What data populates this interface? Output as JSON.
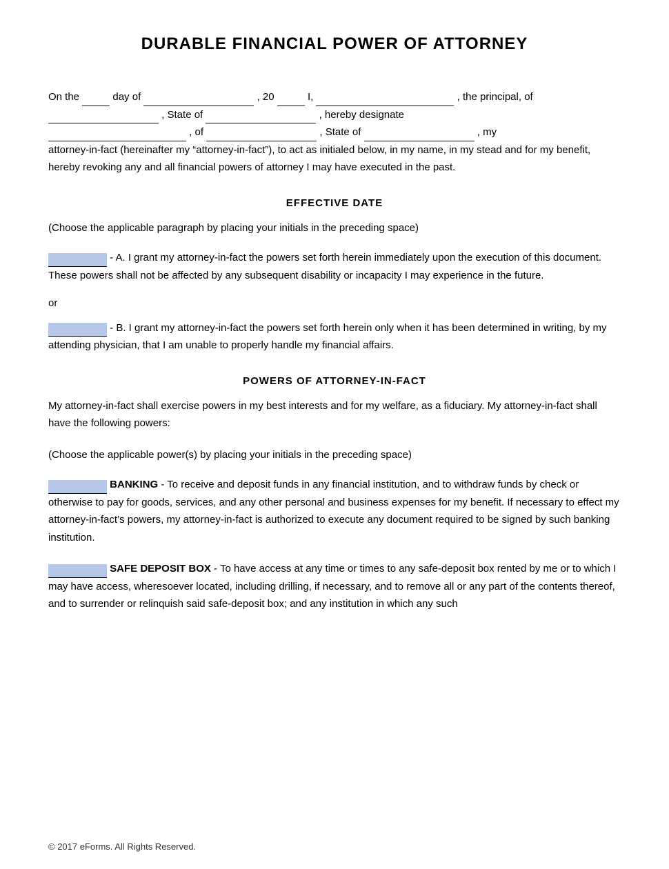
{
  "document": {
    "title": "DURABLE FINANCIAL POWER OF ATTORNEY",
    "intro": {
      "on_the": "On the",
      "day": "day",
      "of_day": "of day",
      "of": "of",
      "comma_20": ", 20",
      "I": "I,",
      "the_principal": ", the principal, of",
      "state_of_1": ", State of",
      "hereby_designate": ", hereby designate",
      "of_2": ", of",
      "state_of_2": ", State of",
      "my": ", my",
      "attorney_text": "attorney-in-fact (hereinafter my “attorney-in-fact”), to act as initialed below, in my name, in my stead and for my benefit, hereby revoking any and all financial powers of attorney I may have executed in the past."
    },
    "effective_date": {
      "heading": "EFFECTIVE DATE",
      "note": "(Choose the applicable paragraph by placing your initials in the preceding space)",
      "option_a": "- A. I grant my attorney-in-fact the powers set forth herein immediately upon the execution of this document. These powers shall not be affected by any subsequent disability or incapacity I may experience in the future.",
      "or": "or",
      "option_b": "- B. I grant my attorney-in-fact the powers set forth herein only when it has been determined in writing, by my attending physician, that I am unable to properly handle my financial affairs."
    },
    "powers": {
      "heading": "POWERS OF ATTORNEY-IN-FACT",
      "intro_1": "My attorney-in-fact shall exercise powers in my best interests and for my welfare, as a fiduciary. My attorney-in-fact shall have the following powers:",
      "note": "(Choose the applicable power(s) by placing your initials in the preceding space)",
      "banking_label": "BANKING",
      "banking_text": "- To receive and deposit funds in any financial institution, and to withdraw funds by check or otherwise to pay for goods, services, and any other personal and business expenses for my benefit.  If necessary to effect my attorney-in-fact’s powers, my attorney-in-fact is authorized to execute any document required to be signed by such banking institution.",
      "safe_deposit_label": "SAFE DEPOSIT BOX",
      "safe_deposit_text": "- To have access at any time or times to any safe-deposit box rented by me or to which I may have access, wheresoever located, including drilling, if necessary, and to remove all or any part of the contents thereof, and to surrender or relinquish said safe-deposit box; and any institution in which any such"
    },
    "footer": {
      "copyright": "© 2017 eForms. All Rights Reserved."
    }
  }
}
